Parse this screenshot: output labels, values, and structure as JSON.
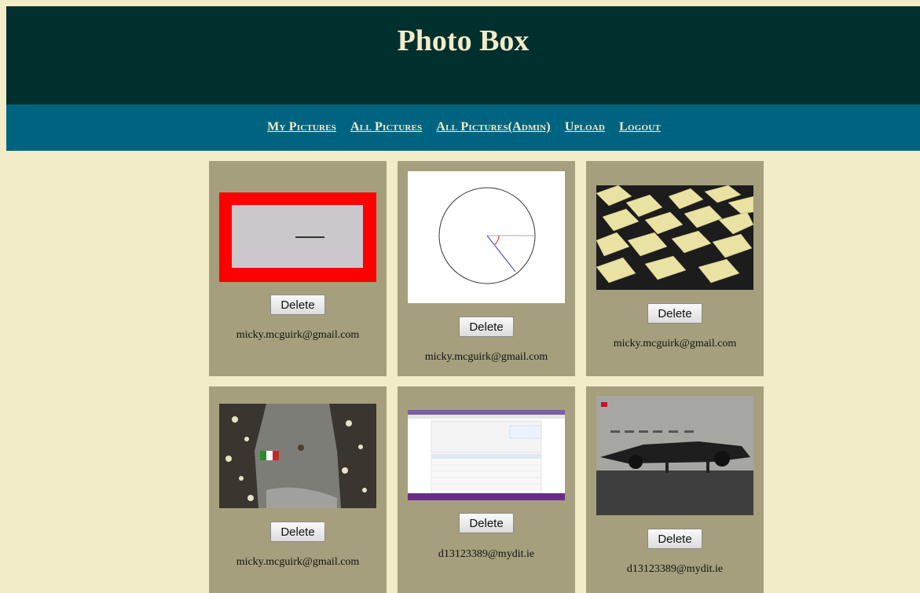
{
  "app": {
    "title": "Photo Box"
  },
  "nav": {
    "items": [
      {
        "label": "My Pictures"
      },
      {
        "label": "All Pictures"
      },
      {
        "label": "All Pictures(Admin)"
      },
      {
        "label": "Upload"
      },
      {
        "label": "Logout"
      }
    ]
  },
  "photos": [
    {
      "delete_label": "Delete",
      "owner": "micky.mcguirk@gmail.com",
      "image": "grey-rectangle-red-border"
    },
    {
      "delete_label": "Delete",
      "owner": "micky.mcguirk@gmail.com",
      "image": "circle-diagram"
    },
    {
      "delete_label": "Delete",
      "owner": "micky.mcguirk@gmail.com",
      "image": "sticky-notes-on-table"
    },
    {
      "delete_label": "Delete",
      "owner": "micky.mcguirk@gmail.com",
      "image": "crowd-street-parade"
    },
    {
      "delete_label": "Delete",
      "owner": "d13123389@mydit.ie",
      "image": "browser-screenshot"
    },
    {
      "delete_label": "Delete",
      "owner": "d13123389@mydit.ie",
      "image": "formula1-car"
    }
  ]
}
